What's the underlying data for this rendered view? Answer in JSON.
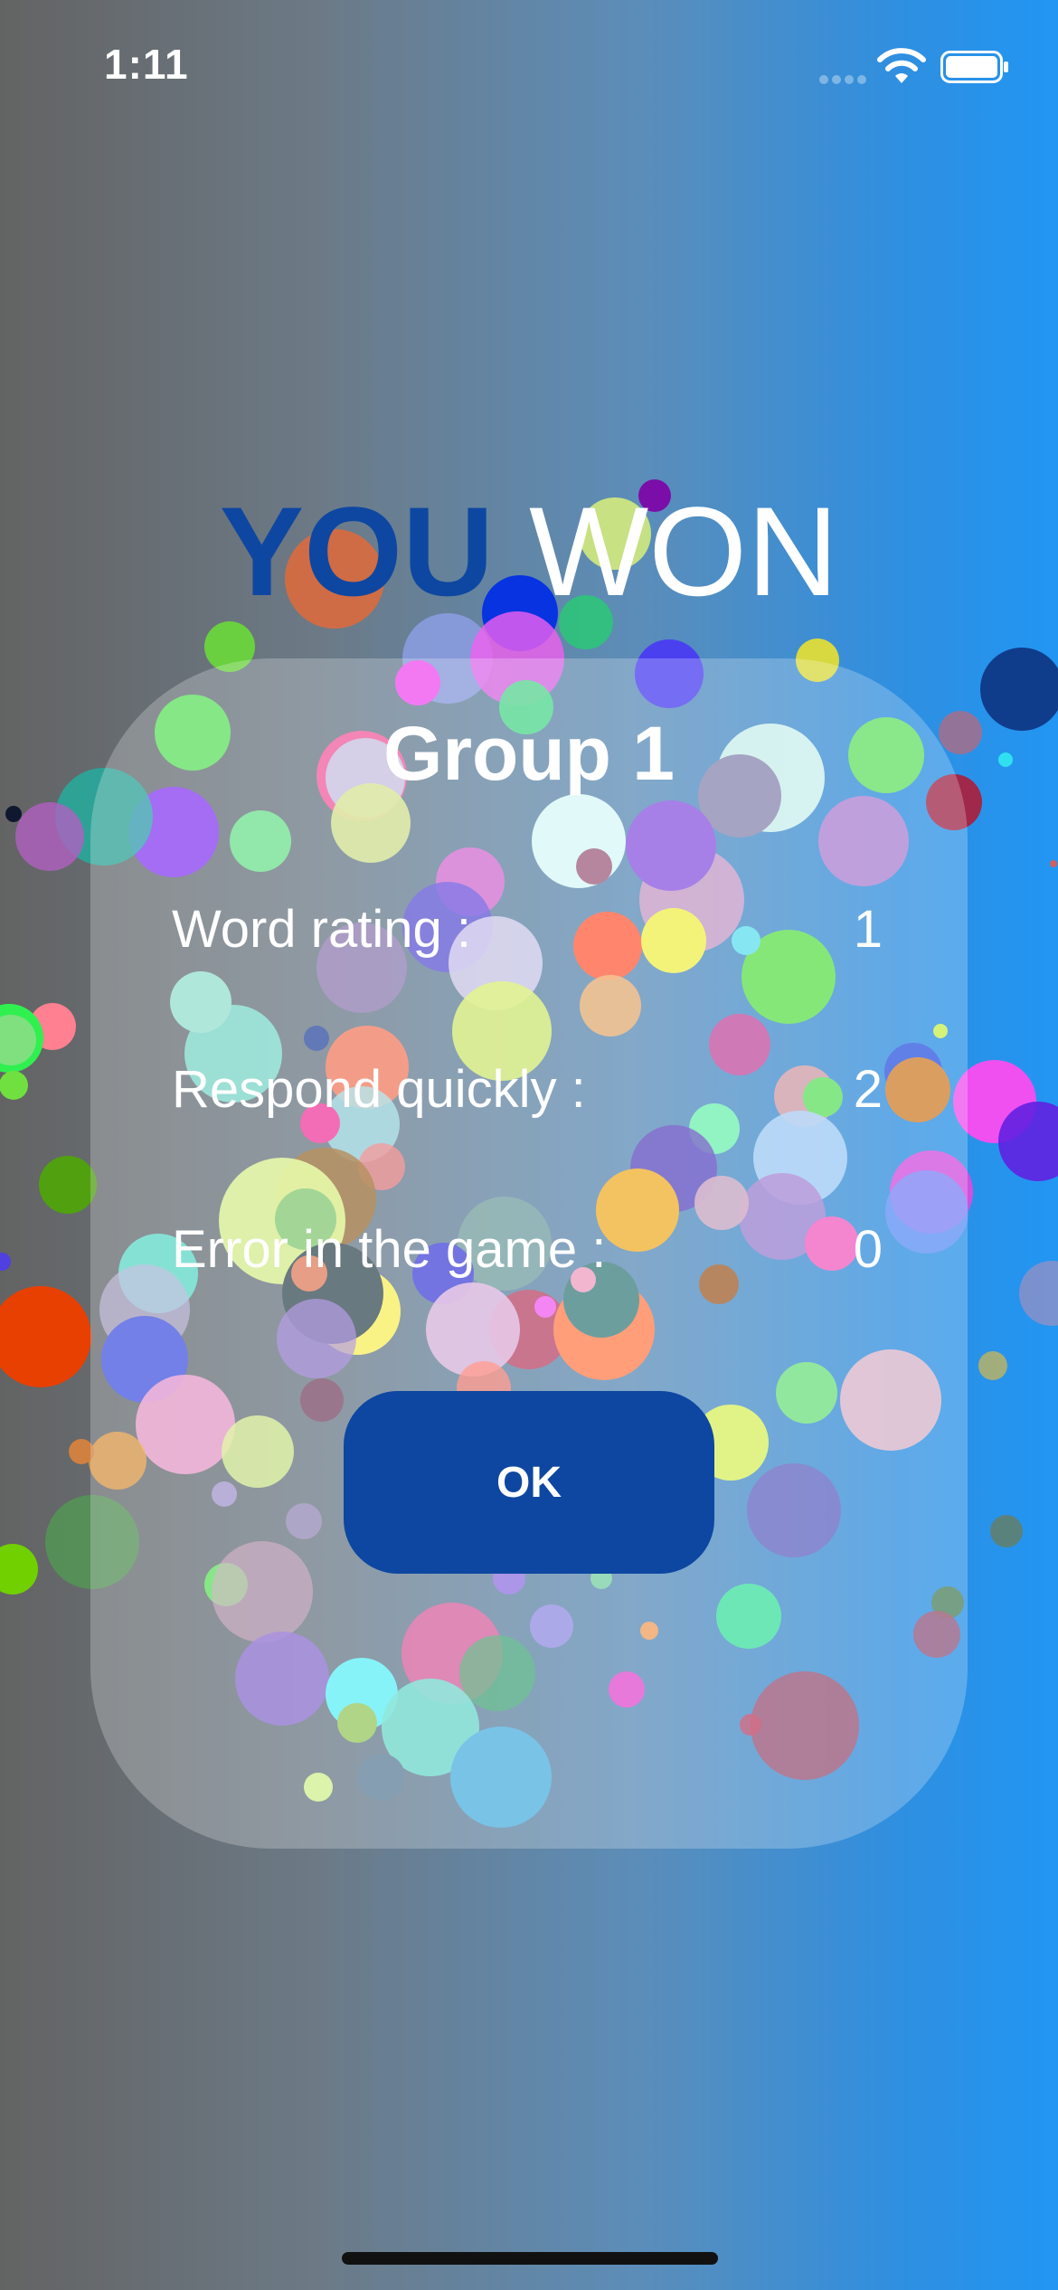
{
  "status_bar": {
    "time": "1:11",
    "icons": [
      "cellular-signal-icon",
      "wifi-icon",
      "battery-icon"
    ]
  },
  "title": {
    "you": "YOU",
    "won": "WON"
  },
  "result_card": {
    "group_title": "Group 1",
    "stats": [
      {
        "label": "Word rating :",
        "value": "1"
      },
      {
        "label": "Respond quickly :",
        "value": "2"
      },
      {
        "label": "Error in the game  :",
        "value": "0"
      }
    ],
    "ok_label": "OK"
  },
  "colors": {
    "title_you": "#0d47a1",
    "ok_button": "#0d47a1",
    "background_start": "#636363",
    "background_end": "#2196f3"
  }
}
